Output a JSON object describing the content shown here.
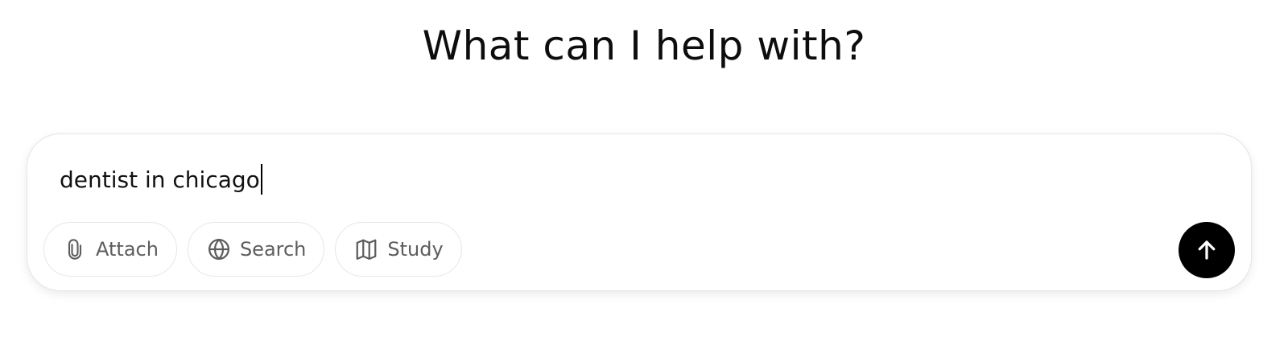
{
  "heading": "What can I help with?",
  "composer": {
    "input_value": "dentist in chicago",
    "tools": [
      {
        "label": "Attach",
        "icon": "paperclip-icon"
      },
      {
        "label": "Search",
        "icon": "globe-icon"
      },
      {
        "label": "Study",
        "icon": "book-icon"
      }
    ],
    "send_icon": "arrow-up-icon"
  },
  "colors": {
    "send_button_bg": "#000000",
    "tool_label": "#5d5d5d",
    "text": "#0d0d0d"
  }
}
